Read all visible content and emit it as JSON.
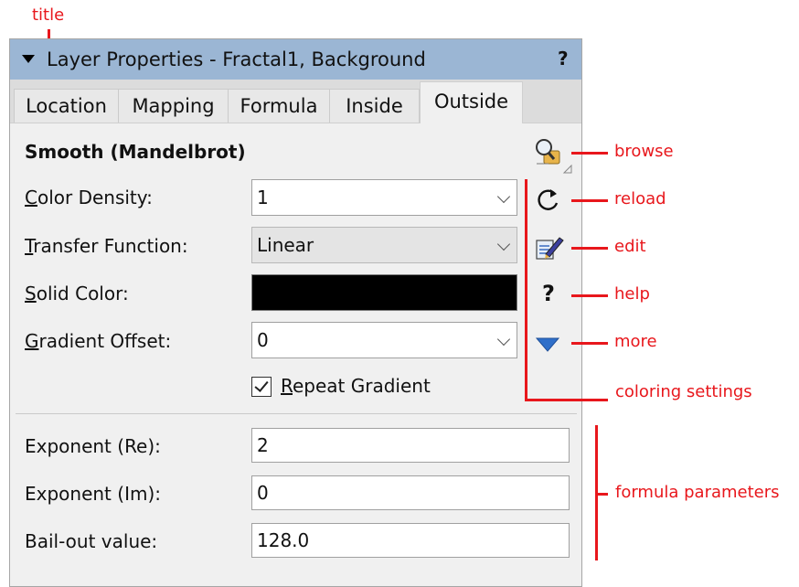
{
  "panel": {
    "title": "Layer Properties - Fractal1, Background",
    "help_label": "?"
  },
  "tabs": [
    {
      "label": "Location",
      "active": false
    },
    {
      "label": "Mapping",
      "active": false
    },
    {
      "label": "Formula",
      "active": false
    },
    {
      "label": "Inside",
      "active": false
    },
    {
      "label": "Outside",
      "active": true
    }
  ],
  "formula_name": "Smooth (Mandelbrot)",
  "coloring": {
    "color_density": {
      "label_prefix": "C",
      "label_rest": "olor Density:",
      "value": "1"
    },
    "transfer_function": {
      "label_prefix": "T",
      "label_rest": "ransfer Function:",
      "value": "Linear"
    },
    "solid_color": {
      "label_prefix": "S",
      "label_rest": "olid Color:",
      "value": "#000000"
    },
    "gradient_offset": {
      "label_prefix": "G",
      "label_rest": "radient Offset:",
      "value": "0"
    },
    "repeat_gradient": {
      "label_prefix": "R",
      "label_rest": "epeat Gradient",
      "checked": true
    }
  },
  "parameters": [
    {
      "label": "Exponent (Re):",
      "value": "2"
    },
    {
      "label": "Exponent (Im):",
      "value": "0"
    },
    {
      "label": "Bail-out value:",
      "value": "128.0"
    }
  ],
  "side_icons": {
    "browse": "browse-icon",
    "reload": "reload-icon",
    "edit": "edit-icon",
    "help": "help-icon",
    "more": "more-icon",
    "help_glyph": "?"
  },
  "annotations": {
    "title": "title",
    "browse": "browse",
    "reload": "reload",
    "edit": "edit",
    "help": "help",
    "more": "more",
    "coloring_settings": "coloring settings",
    "formula_parameters": "formula parameters"
  },
  "colors": {
    "titlebar": "#9bb6d4",
    "annotation": "#e8171c",
    "more_triangle": "#2f6fc9"
  }
}
